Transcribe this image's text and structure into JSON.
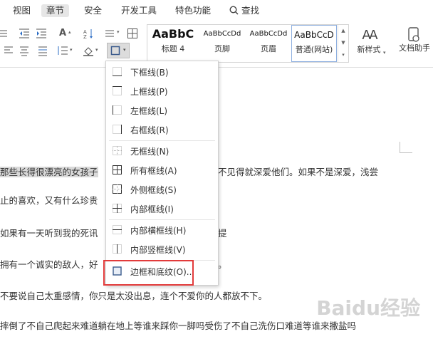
{
  "menu": {
    "tabs": [
      {
        "label": "视图"
      },
      {
        "label": "章节"
      },
      {
        "label": "安全"
      },
      {
        "label": "开发工具"
      },
      {
        "label": "特色功能"
      },
      {
        "label": "查找"
      }
    ]
  },
  "ribbon": {
    "styles": [
      {
        "preview": "AaBbC",
        "label": "标题 4"
      },
      {
        "preview": "AaBbCcDd",
        "label": "页脚"
      },
      {
        "preview": "AaBbCcDd",
        "label": "页眉"
      },
      {
        "preview": "AaBbCcD",
        "label": "普通(网站)"
      }
    ],
    "new_style_label": "新样式",
    "assistant_label": "文档助手",
    "new_style_icon": "AA"
  },
  "dropdown": {
    "items": [
      {
        "label": "下框线(B)",
        "icon": "border-bottom-icon"
      },
      {
        "label": "上框线(P)",
        "icon": "border-top-icon"
      },
      {
        "label": "左框线(L)",
        "icon": "border-left-icon"
      },
      {
        "label": "右框线(R)",
        "icon": "border-right-icon"
      },
      {
        "label": "无框线(N)",
        "icon": "border-none-icon"
      },
      {
        "label": "所有框线(A)",
        "icon": "border-all-icon"
      },
      {
        "label": "外侧框线(S)",
        "icon": "border-outside-icon"
      },
      {
        "label": "内部框线(I)",
        "icon": "border-inside-icon"
      },
      {
        "label": "内部横框线(H)",
        "icon": "border-inside-horizontal-icon"
      },
      {
        "label": "内部竖框线(V)",
        "icon": "border-inside-vertical-icon"
      },
      {
        "label": "边框和底纹(O)...",
        "icon": "borders-and-shading-icon"
      }
    ]
  },
  "document": {
    "lines": [
      {
        "text_hl": "那些长得很漂亮的女孩子",
        "text": "不见得就深爱他们。如果不是深爱，浅尝"
      },
      {
        "text": "止的喜欢，又有什么珍贵"
      },
      {
        "text": "如果有一天听到我的死讯",
        "text2": "提"
      },
      {
        "text": "拥有一个诚实的敌人，好",
        "text2": "。"
      },
      {
        "text": "不要说自己太重感情，你只是太没出息，连个不爱你的人都放不下。"
      },
      {
        "text": "摔倒了不自己爬起来难道躺在地上等谁来踩你一脚吗受伤了不自己洗伤口难道等谁来撒盐吗"
      }
    ]
  },
  "watermark": "Baidu经验"
}
